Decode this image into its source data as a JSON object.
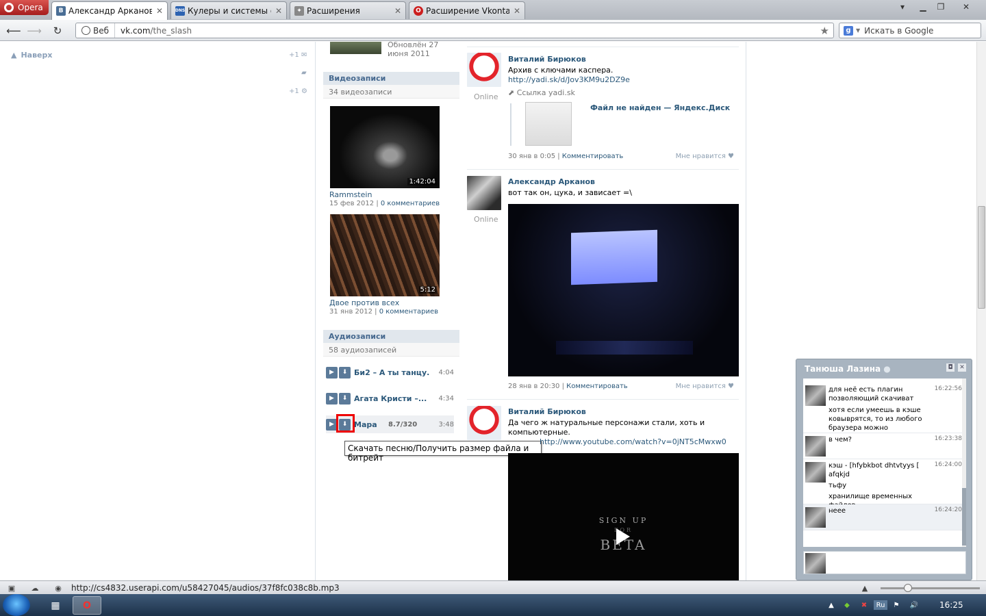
{
  "browser": {
    "menu_label": "Opera",
    "tabs": [
      {
        "label": "Александр Арканов",
        "favicon": "В",
        "favicon_color": "#4a6e95",
        "active": true
      },
      {
        "label": "Кулеры и системы ох...",
        "favicon": "DNS",
        "favicon_color": "#2d63b1",
        "active": false
      },
      {
        "label": "Расширения",
        "favicon": "✦",
        "favicon_color": "#777777",
        "active": false
      },
      {
        "label": "Расширение Vkontakt...",
        "favicon": "O",
        "favicon_color": "#cc1f1f",
        "active": false
      }
    ],
    "address": {
      "badge": "Веб",
      "domain": "vk.com",
      "path": "/the_slash"
    },
    "search": {
      "placeholder": "Искать в Google",
      "engine_letter": "g"
    }
  },
  "left_nav": {
    "up_label": "Наверх",
    "counters": [
      "+1",
      "+1"
    ]
  },
  "sidebar": {
    "album_updated": "Обновлён 27 июня 2011",
    "videos": {
      "heading": "Видеозаписи",
      "count": "34 видеозаписи",
      "items": [
        {
          "title": "Rammstein",
          "duration": "1:42:04",
          "date": "15 фев 2012",
          "comments": "0 комментариев"
        },
        {
          "title": "Двое против всех",
          "duration": "5:12",
          "date": "31 янв 2012",
          "comments": "0 комментариев"
        }
      ]
    },
    "audios": {
      "heading": "Аудиозаписи",
      "count": "58 аудиозаписей",
      "items": [
        {
          "title": "Би2 – А ты танцу...",
          "duration": "4:04"
        },
        {
          "title": "Агата Кристи –...",
          "duration": "4:34"
        },
        {
          "title": "Мара",
          "bitrate": "8.7/320",
          "duration": "3:48"
        }
      ]
    },
    "tooltip": "Скачать песню/Получить размер файла и битрейт"
  },
  "wall": {
    "posts": [
      {
        "author": "Виталий Бирюков",
        "status": "Online",
        "text": "Архив с ключами каспера.",
        "link": "http://yadi.sk/d/Jov3KM9u2DZ9e",
        "attach_label": "Ссылка yadi.sk",
        "attach_title": "Файл не найден — Яндекс.Диск",
        "date": "30 янв в 0:05",
        "comment": "Комментировать",
        "like": "Мне нравится"
      },
      {
        "author": "Александр Арканов",
        "status": "Online",
        "text": "вот так он, цука, и зависает =\\",
        "date": "28 янв в 20:30",
        "comment": "Комментировать",
        "like": "Мне нравится"
      },
      {
        "author": "Виталий Бирюков",
        "text": "Да чего ж натуральные персонажи стали, хоть и компьютерные.",
        "link": "http://www.youtube.com/watch?v=0jNT5cMwxw0",
        "video_text_1": "SIGN UP",
        "video_text_2": "FOR",
        "video_text_3": "BETA"
      }
    ]
  },
  "chat": {
    "contact": "Танюша Лазина",
    "messages": [
      {
        "lines": [
          "для неё есть плагин позволяющий скачиват",
          "хотя если умеешь в кэше ковыврятся, то из любого браузера можно"
        ],
        "time": "16:22:56"
      },
      {
        "lines": [
          "в чем?"
        ],
        "time": "16:23:38"
      },
      {
        "lines": [
          "кэш - [hfybkbot dhtvtyys [ afqkjd",
          "тьфу",
          "хранилище временных файлов"
        ],
        "time": "16:24:00"
      },
      {
        "lines": [
          "неее"
        ],
        "time": "16:24:20"
      }
    ]
  },
  "status_bar": {
    "url": "http://cs4832.userapi.com/u58427045/audios/37f8fc038c8b.mp3"
  },
  "taskbar": {
    "time": "16:25",
    "lang": "Ru"
  }
}
